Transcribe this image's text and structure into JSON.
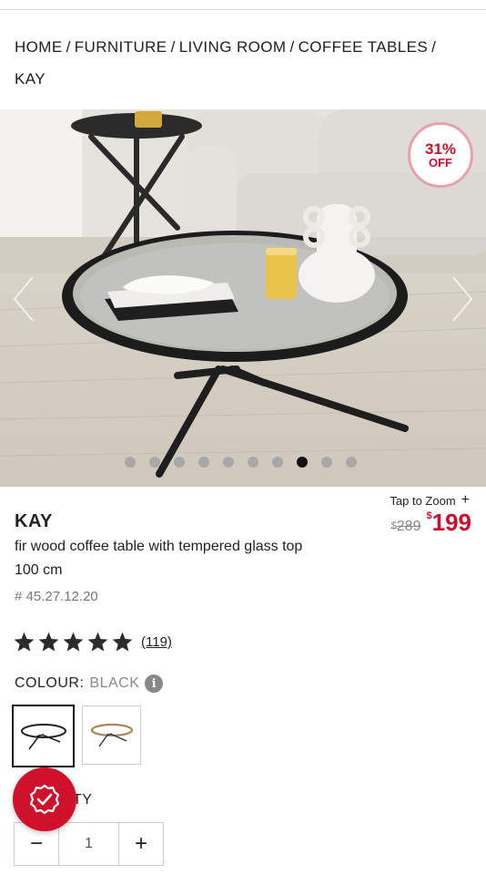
{
  "breadcrumb": {
    "items": [
      "HOME",
      "FURNITURE",
      "LIVING ROOM",
      "COFFEE TABLES",
      "KAY"
    ],
    "separator": "/"
  },
  "badge": {
    "percent": "31%",
    "label": "OFF"
  },
  "gallery": {
    "slide_count": 10,
    "active_index": 7
  },
  "zoom": {
    "label": "Tap to Zoom",
    "icon": "+"
  },
  "price": {
    "old_currency": "$",
    "old_value": "289",
    "new_currency": "$",
    "new_value": "199",
    "sale_color": "#c8102e"
  },
  "product": {
    "name": "KAY",
    "description": "fir wood coffee table with tempered glass top 100 cm",
    "sku": "# 45.27.12.20"
  },
  "rating": {
    "stars": 5,
    "count": "(119)"
  },
  "colour": {
    "label": "COLOUR:",
    "value": "BLACK",
    "info_icon": "i"
  },
  "swatches": [
    {
      "name": "black",
      "selected": true
    },
    {
      "name": "natural",
      "selected": false
    }
  ],
  "quantity": {
    "label_visible": "TY",
    "value": "1",
    "minus": "−",
    "plus": "+"
  }
}
